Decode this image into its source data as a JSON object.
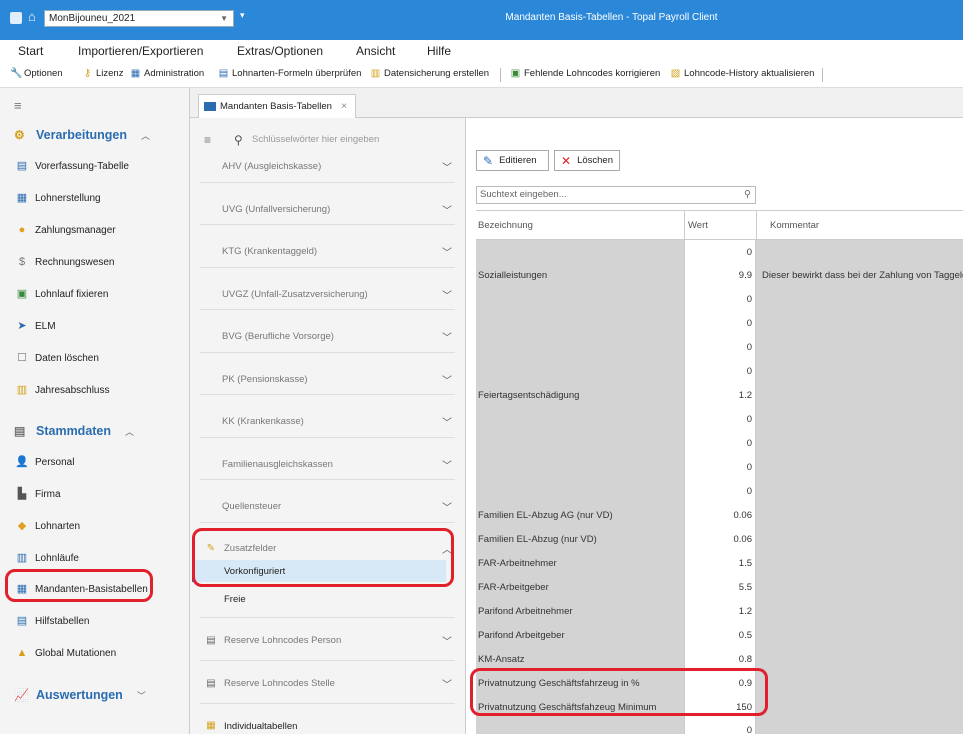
{
  "window": {
    "combo_value": "MonBijouneu_2021",
    "title": "Mandanten Basis-Tabellen - Topal Payroll Client"
  },
  "menu": [
    "Start",
    "Importieren/Exportieren",
    "Extras/Optionen",
    "Ansicht",
    "Hilfe"
  ],
  "toolbar": {
    "optionen": "Optionen",
    "lizenz": "Lizenz",
    "administration": "Administration",
    "formeln": "Lohnarten-Formeln überprüfen",
    "datensicherung": "Datensicherung erstellen",
    "fehlende": "Fehlende Lohncodes korrigieren",
    "history": "Lohncode-History aktualisieren"
  },
  "sidebar": {
    "verarbeitungen": "Verarbeitungen",
    "verarbeitungen_items": [
      "Vorerfassung-Tabelle",
      "Lohnerstellung",
      "Zahlungsmanager",
      "Rechnungswesen",
      "Lohnlauf fixieren",
      "ELM",
      "Daten löschen",
      "Jahresabschluss"
    ],
    "stammdaten": "Stammdaten",
    "stammdaten_items": [
      "Personal",
      "Firma",
      "Lohnarten",
      "Lohnläufe",
      "Mandanten-Basistabellen",
      "Hilfstabellen",
      "Global Mutationen"
    ],
    "auswertungen": "Auswertungen"
  },
  "tab": {
    "label": "Mandanten Basis-Tabellen"
  },
  "middle": {
    "search_placeholder": "Schlüsselwörter hier eingeben",
    "sections": [
      "AHV (Ausgleichskasse)",
      "UVG (Unfallversicherung)",
      "KTG (Krankentaggeld)",
      "UVGZ (Unfall-Zusatzversicherung)",
      "BVG (Berufliche Vorsorge)",
      "PK (Pensionskasse)",
      "KK (Krankenkasse)",
      "Familienausgleichskassen",
      "Quellensteuer"
    ],
    "zusatzfelder": "Zusatzfelder",
    "zusatz_sub": [
      "Vorkonfiguriert",
      "Freie"
    ],
    "reserve_person": "Reserve Lohncodes Person",
    "reserve_stelle": "Reserve Lohncodes Stelle",
    "individual": "Individualtabellen"
  },
  "content": {
    "edit_button": "Editieren",
    "delete_button": "Löschen",
    "search_placeholder": "Suchtext eingeben...",
    "columns": [
      "Bezeichnung",
      "Wert",
      "Kommentar"
    ],
    "rows": [
      {
        "name": "",
        "value": "0",
        "comment": ""
      },
      {
        "name": "Sozialleistungen",
        "value": "9.9",
        "comment": "Dieser bewirkt dass bei der Zahlung von Taggeld"
      },
      {
        "name": "",
        "value": "0",
        "comment": ""
      },
      {
        "name": "",
        "value": "0",
        "comment": ""
      },
      {
        "name": "",
        "value": "0",
        "comment": ""
      },
      {
        "name": "",
        "value": "0",
        "comment": ""
      },
      {
        "name": "Feiertagsentschädigung",
        "value": "1.2",
        "comment": ""
      },
      {
        "name": "",
        "value": "0",
        "comment": ""
      },
      {
        "name": "",
        "value": "0",
        "comment": ""
      },
      {
        "name": "",
        "value": "0",
        "comment": ""
      },
      {
        "name": "",
        "value": "0",
        "comment": ""
      },
      {
        "name": "Familien EL-Abzug AG (nur VD)",
        "value": "0.06",
        "comment": ""
      },
      {
        "name": "Familien EL-Abzug (nur VD)",
        "value": "0.06",
        "comment": ""
      },
      {
        "name": "FAR-Arbeitnehmer",
        "value": "1.5",
        "comment": ""
      },
      {
        "name": "FAR-Arbeitgeber",
        "value": "5.5",
        "comment": ""
      },
      {
        "name": "Parifond Arbeitnehmer",
        "value": "1.2",
        "comment": ""
      },
      {
        "name": "Parifond Arbeitgeber",
        "value": "0.5",
        "comment": ""
      },
      {
        "name": "KM-Ansatz",
        "value": "0.8",
        "comment": ""
      },
      {
        "name": "Privatnutzung Geschäftsfahrzeug in %",
        "value": "0.9",
        "comment": ""
      },
      {
        "name": "Privatnutzung Geschäftsfahzeug Minimum",
        "value": "150",
        "comment": ""
      },
      {
        "name": "",
        "value": "0",
        "comment": ""
      }
    ]
  },
  "colors": {
    "accent": "#2b88d8",
    "highlight": "#e0202a",
    "selection": "#d7e9f7"
  }
}
